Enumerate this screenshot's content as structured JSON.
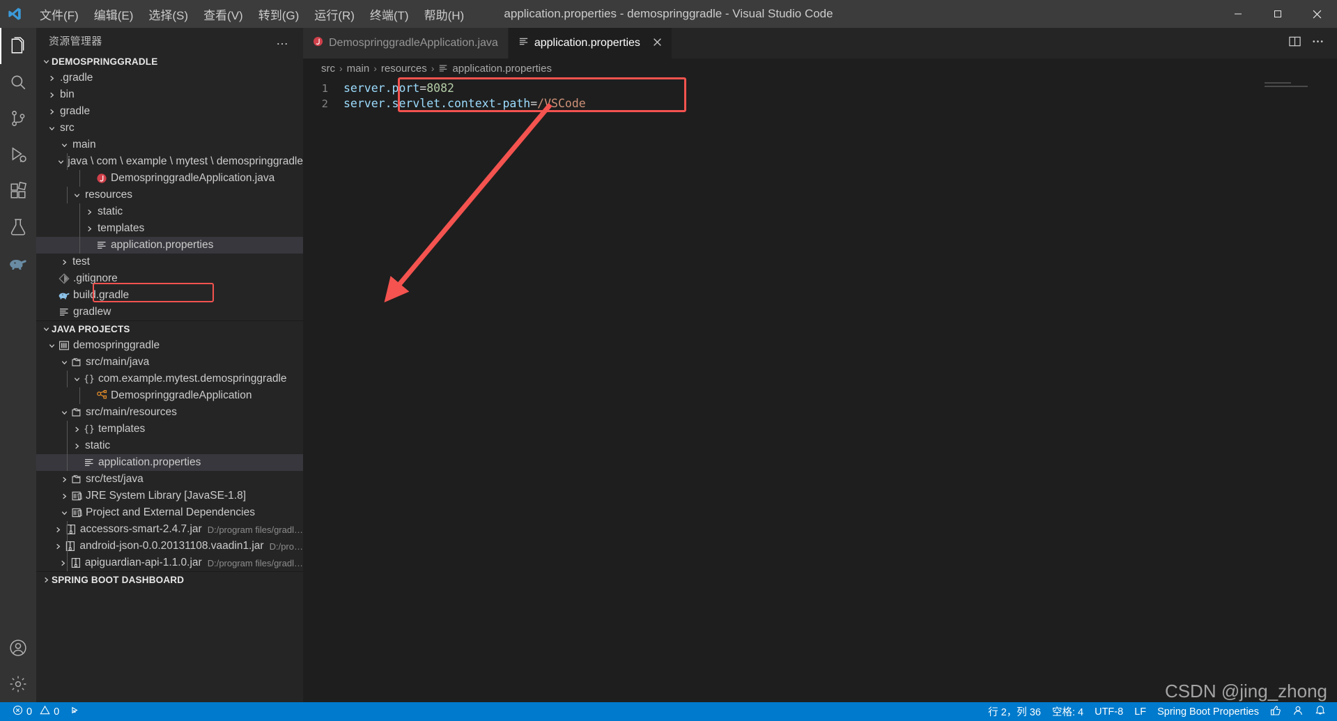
{
  "titlebar": {
    "logo_icon": "vscode-logo-icon",
    "menus": [
      {
        "label": "文件(F)",
        "name": "menu-file"
      },
      {
        "label": "编辑(E)",
        "name": "menu-edit"
      },
      {
        "label": "选择(S)",
        "name": "menu-selection"
      },
      {
        "label": "查看(V)",
        "name": "menu-view"
      },
      {
        "label": "转到(G)",
        "name": "menu-go"
      },
      {
        "label": "运行(R)",
        "name": "menu-run"
      },
      {
        "label": "终端(T)",
        "name": "menu-terminal"
      },
      {
        "label": "帮助(H)",
        "name": "menu-help"
      }
    ],
    "window_title": "application.properties - demospringgradle - Visual Studio Code",
    "minimize_icon": "minimize-icon",
    "maximize_icon": "maximize-icon",
    "close_icon": "close-icon"
  },
  "activitybar": {
    "items": [
      {
        "name": "activity-explorer",
        "icon": "files-icon",
        "active": true
      },
      {
        "name": "activity-search",
        "icon": "search-icon",
        "active": false
      },
      {
        "name": "activity-source-control",
        "icon": "source-control-icon",
        "active": false
      },
      {
        "name": "activity-run-debug",
        "icon": "run-debug-icon",
        "active": false
      },
      {
        "name": "activity-extensions",
        "icon": "extensions-icon",
        "active": false
      },
      {
        "name": "activity-testing",
        "icon": "beaker-icon",
        "active": false
      },
      {
        "name": "activity-gradle",
        "icon": "gradle-elephant-icon",
        "active": false
      }
    ],
    "bottom_items": [
      {
        "name": "activity-accounts",
        "icon": "account-icon"
      },
      {
        "name": "activity-settings",
        "icon": "gear-icon"
      }
    ]
  },
  "sidebar": {
    "title": "资源管理器",
    "more_actions": "…",
    "explorer": {
      "header": "DEMOSPRINGGRADLE",
      "rows": [
        {
          "label": ".gradle",
          "icon": "folder-icon",
          "twisty": "collapsed",
          "depth": 1
        },
        {
          "label": "bin",
          "icon": "folder-icon",
          "twisty": "collapsed",
          "depth": 1
        },
        {
          "label": "gradle",
          "icon": "folder-icon",
          "twisty": "collapsed",
          "depth": 1
        },
        {
          "label": "src",
          "icon": "folder-icon",
          "twisty": "expanded",
          "depth": 1
        },
        {
          "label": "main",
          "icon": "folder-icon",
          "twisty": "expanded",
          "depth": 2
        },
        {
          "label": "java \\ com \\ example \\ mytest \\ demospringgradle",
          "icon": "folder-icon",
          "twisty": "expanded",
          "depth": 3
        },
        {
          "label": "DemospringgradleApplication.java",
          "icon": "java-file-icon",
          "twisty": "none",
          "depth": 4
        },
        {
          "label": "resources",
          "icon": "folder-icon",
          "twisty": "expanded",
          "depth": 3
        },
        {
          "label": "static",
          "icon": "folder-icon",
          "twisty": "collapsed",
          "depth": 4
        },
        {
          "label": "templates",
          "icon": "folder-icon",
          "twisty": "collapsed",
          "depth": 4
        },
        {
          "label": "application.properties",
          "icon": "properties-file-icon",
          "twisty": "none",
          "depth": 4,
          "selected": true,
          "annotated": true
        },
        {
          "label": "test",
          "icon": "folder-icon",
          "twisty": "collapsed",
          "depth": 2
        },
        {
          "label": ".gitignore",
          "icon": "git-icon",
          "twisty": "none",
          "depth": 1
        },
        {
          "label": "build.gradle",
          "icon": "gradle-elephant-icon",
          "twisty": "none",
          "depth": 1
        },
        {
          "label": "gradlew",
          "icon": "properties-file-icon",
          "twisty": "none",
          "depth": 1
        }
      ]
    },
    "java_projects": {
      "header": "JAVA PROJECTS",
      "rows": [
        {
          "label": "demospringgradle",
          "icon": "project-icon",
          "twisty": "expanded",
          "depth": 1
        },
        {
          "label": "src/main/java",
          "icon": "package-root-icon",
          "twisty": "expanded",
          "depth": 2
        },
        {
          "label": "com.example.mytest.demospringgradle",
          "icon": "package-icon",
          "twisty": "expanded",
          "depth": 3
        },
        {
          "label": "DemospringgradleApplication",
          "icon": "class-icon",
          "twisty": "none",
          "depth": 4
        },
        {
          "label": "src/main/resources",
          "icon": "package-root-icon",
          "twisty": "expanded",
          "depth": 2
        },
        {
          "label": "templates",
          "icon": "package-icon",
          "twisty": "collapsed",
          "depth": 3
        },
        {
          "label": "static",
          "icon": "none-icon",
          "twisty": "collapsed",
          "depth": 3
        },
        {
          "label": "application.properties",
          "icon": "properties-file-icon",
          "twisty": "none",
          "depth": 3,
          "selected": true
        },
        {
          "label": "src/test/java",
          "icon": "package-root-icon",
          "twisty": "collapsed",
          "depth": 2
        },
        {
          "label": "JRE System Library [JavaSE-1.8]",
          "icon": "library-icon",
          "twisty": "collapsed",
          "depth": 2
        },
        {
          "label": "Project and External Dependencies",
          "icon": "library-icon",
          "twisty": "expanded",
          "depth": 2
        },
        {
          "label": "accessors-smart-2.4.7.jar",
          "sublabel": "D:/program files/gradl…",
          "icon": "jar-icon",
          "twisty": "collapsed",
          "depth": 3
        },
        {
          "label": "android-json-0.0.20131108.vaadin1.jar",
          "sublabel": "D:/pro…",
          "icon": "jar-icon",
          "twisty": "collapsed",
          "depth": 3
        },
        {
          "label": "apiguardian-api-1.1.0.jar",
          "sublabel": "D:/program files/gradl…",
          "icon": "jar-icon",
          "twisty": "collapsed",
          "depth": 3
        }
      ]
    },
    "spring_boot_dashboard": {
      "header": "SPRING BOOT DASHBOARD"
    }
  },
  "editor": {
    "tabs": [
      {
        "label": "DemospringgradleApplication.java",
        "icon": "java-file-icon",
        "active": false,
        "has_close": false
      },
      {
        "label": "application.properties",
        "icon": "properties-file-icon",
        "active": true,
        "has_close": true,
        "close_icon": "close-icon"
      }
    ],
    "actions": [
      {
        "name": "split-editor-icon",
        "icon": "split-editor-icon"
      },
      {
        "name": "more-actions-icon",
        "icon": "ellipsis-icon"
      }
    ],
    "breadcrumbs": [
      "src",
      "main",
      "resources",
      "application.properties"
    ],
    "breadcrumb_separator": "›",
    "breadcrumb_file_icon": "properties-file-icon",
    "lines": [
      {
        "number": "1",
        "key": "server.port",
        "eq": "=",
        "value": "8082",
        "value_type": "num"
      },
      {
        "number": "2",
        "key": "server.servlet.context-path",
        "eq": "=",
        "value": "/VSCode",
        "value_type": "str"
      }
    ]
  },
  "annotations": {
    "box_color": "#f4534f",
    "arrow_color": "#f4534f"
  },
  "statusbar": {
    "errors_icon": "error-circle-icon",
    "errors": "0",
    "warnings_icon": "warning-triangle-icon",
    "warnings": "0",
    "remote_icon": "remote-connect-icon",
    "cursor_position": "行 2，列 36",
    "indentation": "空格: 4",
    "encoding": "UTF-8",
    "eol": "LF",
    "language_mode": "Spring Boot Properties",
    "feedback_icon": "thumbs-up-icon",
    "account_icon": "person-icon",
    "bell_icon": "bell-icon"
  },
  "watermark": "CSDN @jing_zhong"
}
